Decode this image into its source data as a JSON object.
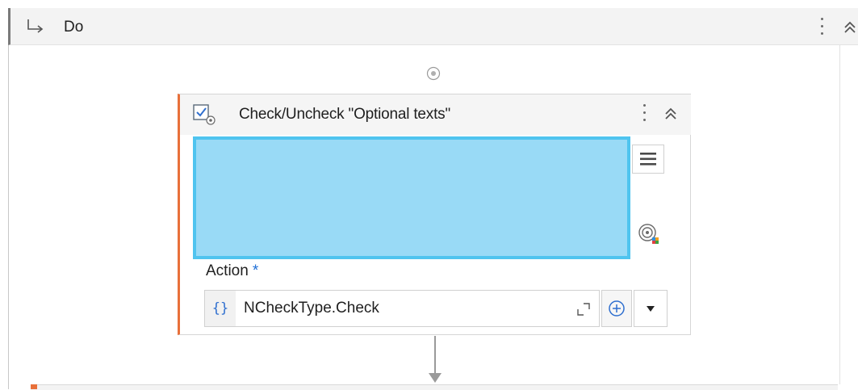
{
  "sequence": {
    "title": "Do",
    "icons": {
      "arrow": "turn-down-right-arrow-icon",
      "more": "kebab-menu-icon",
      "collapse": "double-chevron-up-icon"
    }
  },
  "add_activity_icon": "add-circle-icon",
  "activity": {
    "title": "Check/Uncheck \"Optional texts\"",
    "icon": "checkbox-check-icon",
    "accent_color": "#e8703a",
    "preview_color": "#99daf6",
    "preview_border_color": "#4fc4ef",
    "menu_icon": "hamburger-menu-icon",
    "target_icon": "indicate-target-icon",
    "action": {
      "label": "Action",
      "required_marker": "*",
      "expression_tag": "{}",
      "value": "NCheckType.Check",
      "expand_icon": "expand-editor-icon",
      "plus_icon": "plus-circle-icon",
      "dropdown_icon": "caret-down-icon"
    }
  },
  "connector_icon": "arrow-down-icon"
}
